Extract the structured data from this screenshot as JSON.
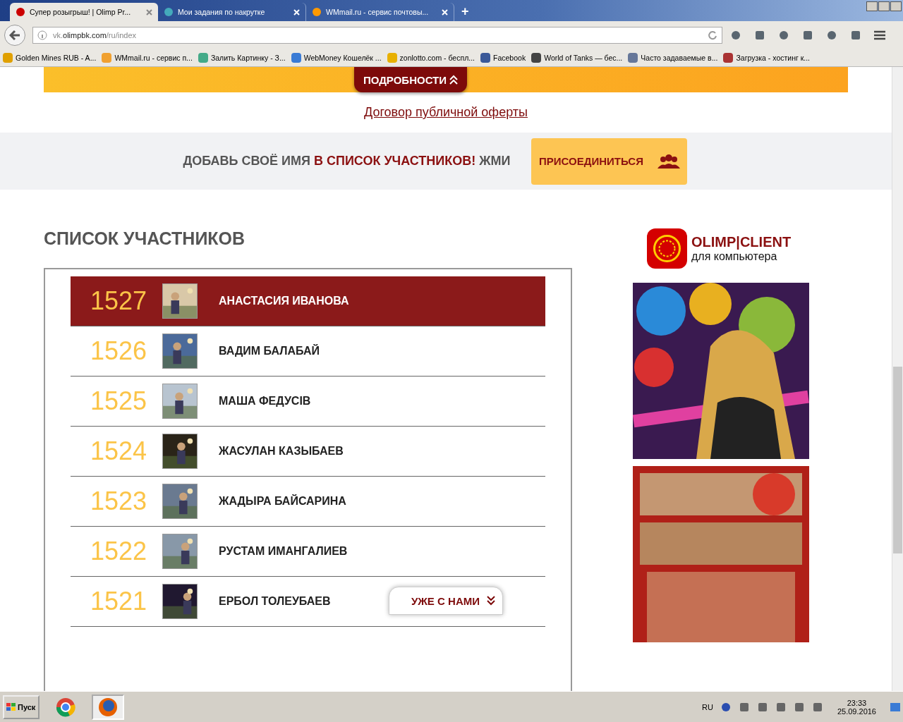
{
  "browser": {
    "tabs": [
      {
        "title": "Супер розыгрыш! | Olimp Pr...",
        "selected": true
      },
      {
        "title": "Мои задания по накрутке",
        "selected": false
      },
      {
        "title": "WMmail.ru - сервис почтовы...",
        "selected": false
      }
    ],
    "new_tab": "+",
    "address": {
      "host_prefix": "vk.",
      "host": "olimpbk.com",
      "path": "/ru/index"
    },
    "bookmarks": [
      "Golden Mines RUB - A...",
      "WMmail.ru - сервис п...",
      "Залить Картинку - З...",
      "WebMoney Кошелёк ...",
      "zonlotto.com - беспл...",
      "Facebook",
      "World of Tanks — бес...",
      "Часто задаваемые в...",
      "Загрузка - хостинг к..."
    ]
  },
  "banner": {
    "button": "ПОДРОБНОСТИ"
  },
  "offer_link": "Договор публичной оферты",
  "join": {
    "text_before": "ДОБАВЬ СВОЁ ИМЯ ",
    "text_accent": "В СПИСОК УЧАСТНИКОВ!",
    "text_after": " ЖМИ",
    "button": "ПРИСОЕДИНИТЬСЯ"
  },
  "participants": {
    "heading": "СПИСОК УЧАСТНИКОВ",
    "rows": [
      {
        "number": "1527",
        "name": "АНАСТАСИЯ ИВАНОВА",
        "selected": true
      },
      {
        "number": "1526",
        "name": "ВАДИМ БАЛАБАЙ",
        "selected": false
      },
      {
        "number": "1525",
        "name": "МАША ФЕДУСІВ",
        "selected": false
      },
      {
        "number": "1524",
        "name": "ЖАСУЛАН КАЗЫБАЕВ",
        "selected": false
      },
      {
        "number": "1523",
        "name": "ЖАДЫРА БАЙСАРИНА",
        "selected": false
      },
      {
        "number": "1522",
        "name": "РУСТАМ ИМАНГАЛИЕВ",
        "selected": false
      },
      {
        "number": "1521",
        "name": "ЕРБОЛ ТОЛЕУБАЕВ",
        "selected": false
      }
    ],
    "already_button": "УЖЕ С НАМИ"
  },
  "sidebar": {
    "logo_title": "OLIMP|CLIENT",
    "logo_subtitle": "для компьютера"
  },
  "taskbar": {
    "start": "Пуск",
    "language": "RU",
    "time": "23:33",
    "date": "25.09.2016"
  }
}
